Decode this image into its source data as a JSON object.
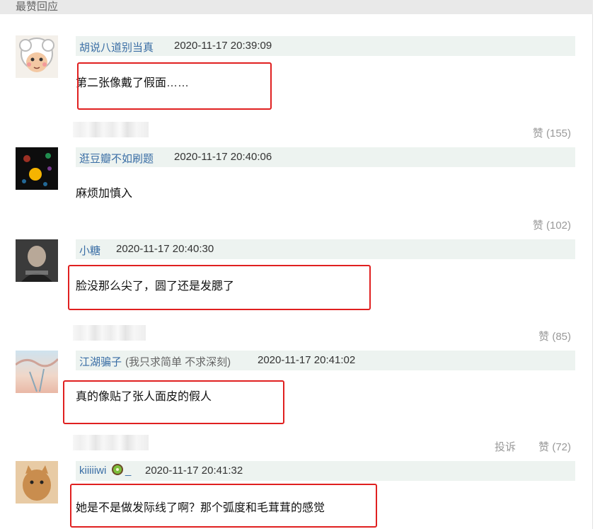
{
  "section": {
    "title": "最赞回应"
  },
  "comments": [
    {
      "user": "胡说八道别当真",
      "time": "2020-11-17 20:39:09",
      "text": "第二张像戴了假面……",
      "like_label": "赞 (155)"
    },
    {
      "user": "逛豆瓣不如刷题",
      "time": "2020-11-17 20:40:06",
      "text": "麻烦加慎入",
      "like_label": "赞 (102)"
    },
    {
      "user": "小糖",
      "time": "2020-11-17 20:40:30",
      "text": "脸没那么尖了，圆了还是发腮了",
      "like_label": "赞 (85)"
    },
    {
      "user": "江湖骗子",
      "signature": "(我只求简单 不求深刻)",
      "time": "2020-11-17 20:41:02",
      "text": "真的像贴了张人面皮的假人",
      "report_label": "投诉",
      "like_label": "赞 (72)"
    },
    {
      "user": "kiiiiiwi",
      "user_suffix": "_",
      "time": "2020-11-17 20:41:32",
      "text": "她是不是做发际线了啊？那个弧度和毛茸茸的感觉"
    }
  ]
}
